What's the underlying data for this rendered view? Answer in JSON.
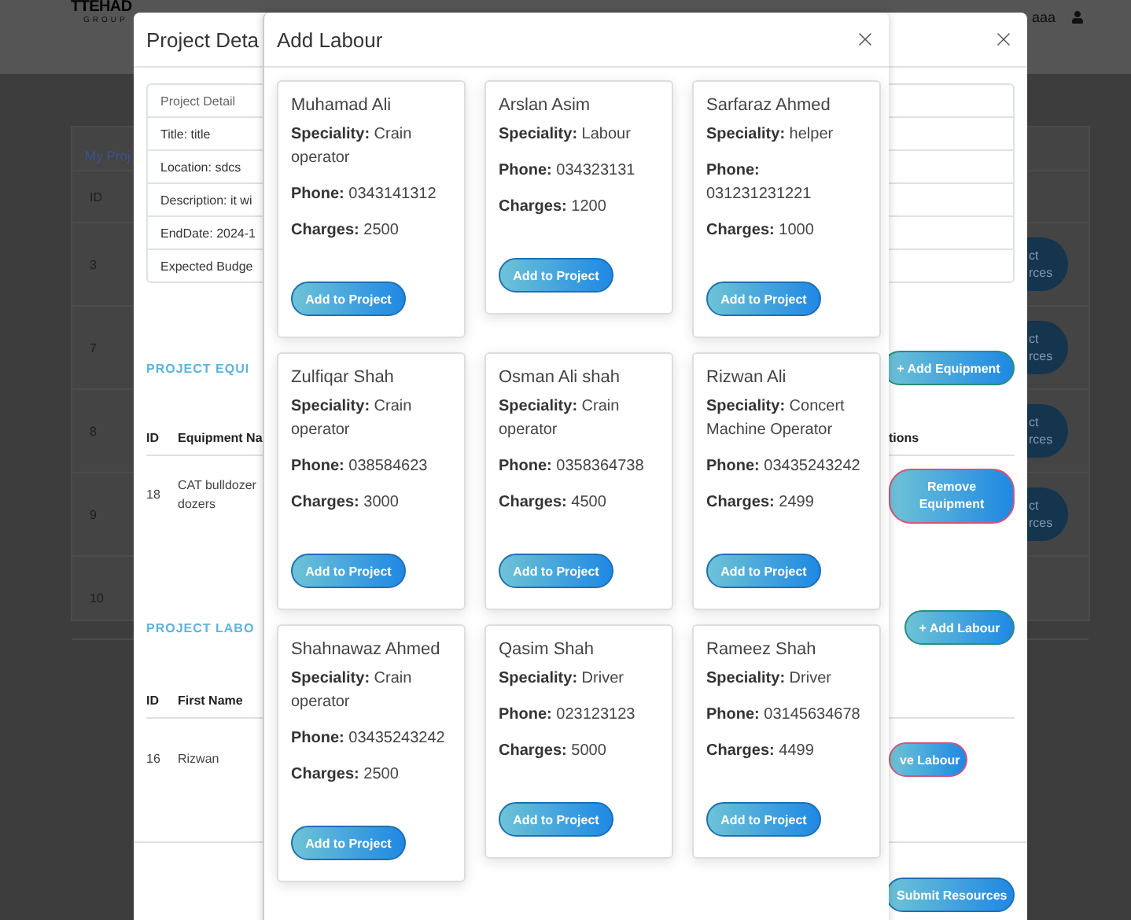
{
  "background": {
    "logo": "TTEHAD",
    "logo_sub": "GROUP",
    "user_name": "aaa",
    "card_title": "My Proj",
    "id_header": "ID",
    "rows": [
      {
        "id": "3",
        "action": "ct rces"
      },
      {
        "id": "7",
        "action": "ct rces"
      },
      {
        "id": "8",
        "action": "ct rces"
      },
      {
        "id": "9",
        "action": "ct rces"
      },
      {
        "id": "10",
        "action": ""
      }
    ]
  },
  "project_detail": {
    "title": "Project Deta",
    "details": [
      "Project Detail",
      "Title: title",
      "Location: sdcs",
      "Description: it wi",
      "EndDate: 2024-1",
      "Expected Budge"
    ],
    "equipment": {
      "heading": "PROJECT EQUI",
      "add_button": "+ Add Equipment",
      "columns": [
        "ID",
        "Equipment Na",
        "tions"
      ],
      "rows": [
        {
          "id": "18",
          "name": "CAT bulldozer dozers",
          "action": "Remove Equipment"
        }
      ]
    },
    "labour": {
      "heading": "PROJECT LABO",
      "add_button": "+ Add Labour",
      "columns": [
        "ID",
        "First Name"
      ],
      "rows": [
        {
          "id": "16",
          "first_name": "Rizwan",
          "action": "ve Labour"
        }
      ]
    },
    "submit_button": "Submit Resources"
  },
  "add_labour": {
    "title": "Add Labour",
    "labourers": [
      {
        "name": "Muhamad Ali",
        "speciality": "**Speciality:** Crain operator",
        "phone": "**Phone:** 0343141312",
        "charges": "**Charges:** 2500",
        "button": "Add to Project"
      },
      {
        "name": "Arslan Asim",
        "speciality": "**Speciality:** Labour",
        "phone": "**Phone:** 034323131",
        "charges": "**Charges:** 1200",
        "button": "Add to Project"
      },
      {
        "name": "Sarfaraz Ahmed",
        "speciality": "**Speciality:** helper",
        "phone": "**Phone:** 031231231221",
        "charges": "**Charges:** 1000",
        "button": "Add to Project"
      },
      {
        "name": "Zulfiqar Shah",
        "speciality": "**Speciality:** Crain operator",
        "phone": "**Phone:** 038584623",
        "charges": "**Charges:** 3000",
        "button": "Add to Project"
      },
      {
        "name": "Osman Ali shah",
        "speciality": "**Speciality:** Crain operator",
        "phone": "**Phone:** 0358364738",
        "charges": "**Charges:** 4500",
        "button": "Add to Project"
      },
      {
        "name": "Rizwan Ali",
        "speciality": "**Speciality:** Concert Machine Operator",
        "phone": "**Phone:** 03435243242",
        "charges": "**Charges:** 2499",
        "button": "Add to Project"
      },
      {
        "name": "Shahnawaz Ahmed",
        "speciality": "**Speciality:** Crain operator",
        "phone": "**Phone:** 03435243242",
        "charges": "**Charges:** 2500",
        "button": "Add to Project"
      },
      {
        "name": "Qasim Shah",
        "speciality": "**Speciality:** Driver",
        "phone": "**Phone:** 023123123",
        "charges": "**Charges:** 5000",
        "button": "Add to Project"
      },
      {
        "name": "Rameez Shah",
        "speciality": "**Speciality:** Driver",
        "phone": "**Phone:** 03145634678",
        "charges": "**Charges:** 4499",
        "button": "Add to Project"
      }
    ]
  }
}
